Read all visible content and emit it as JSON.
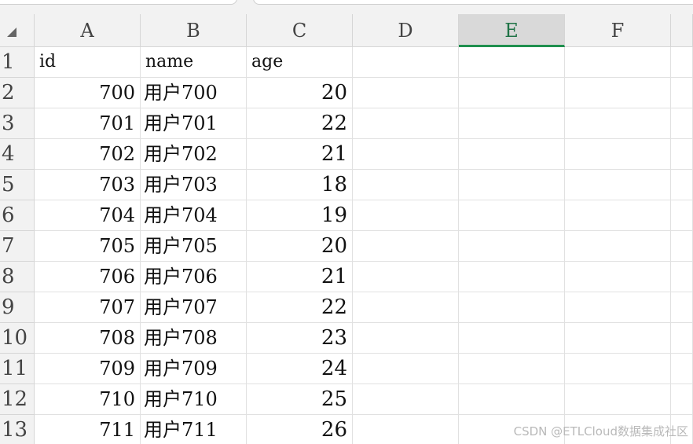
{
  "columns": [
    "A",
    "B",
    "C",
    "D",
    "E",
    "F"
  ],
  "selected_column": "E",
  "rows": [
    {
      "num": "1",
      "a": "id",
      "b": "name",
      "c": "age"
    },
    {
      "num": "2",
      "a": "700",
      "b": "用户700",
      "c": "20"
    },
    {
      "num": "3",
      "a": "701",
      "b": "用户701",
      "c": "22"
    },
    {
      "num": "4",
      "a": "702",
      "b": "用户702",
      "c": "21"
    },
    {
      "num": "5",
      "a": "703",
      "b": "用户703",
      "c": "18"
    },
    {
      "num": "6",
      "a": "704",
      "b": "用户704",
      "c": "19"
    },
    {
      "num": "7",
      "a": "705",
      "b": "用户705",
      "c": "20"
    },
    {
      "num": "8",
      "a": "706",
      "b": "用户706",
      "c": "21"
    },
    {
      "num": "9",
      "a": "707",
      "b": "用户707",
      "c": "22"
    },
    {
      "num": "10",
      "a": "708",
      "b": "用户708",
      "c": "23"
    },
    {
      "num": "11",
      "a": "709",
      "b": "用户709",
      "c": "24"
    },
    {
      "num": "12",
      "a": "710",
      "b": "用户710",
      "c": "25"
    },
    {
      "num": "13",
      "a": "711",
      "b": "用户711",
      "c": "26"
    }
  ],
  "watermark": "CSDN @ETLCloud数据集成社区",
  "colors": {
    "selected_column_underline": "#1f8f4e",
    "selected_column_text": "#1f7346",
    "header_bg": "#f2f2f2",
    "gridline": "#e1e1e1"
  }
}
